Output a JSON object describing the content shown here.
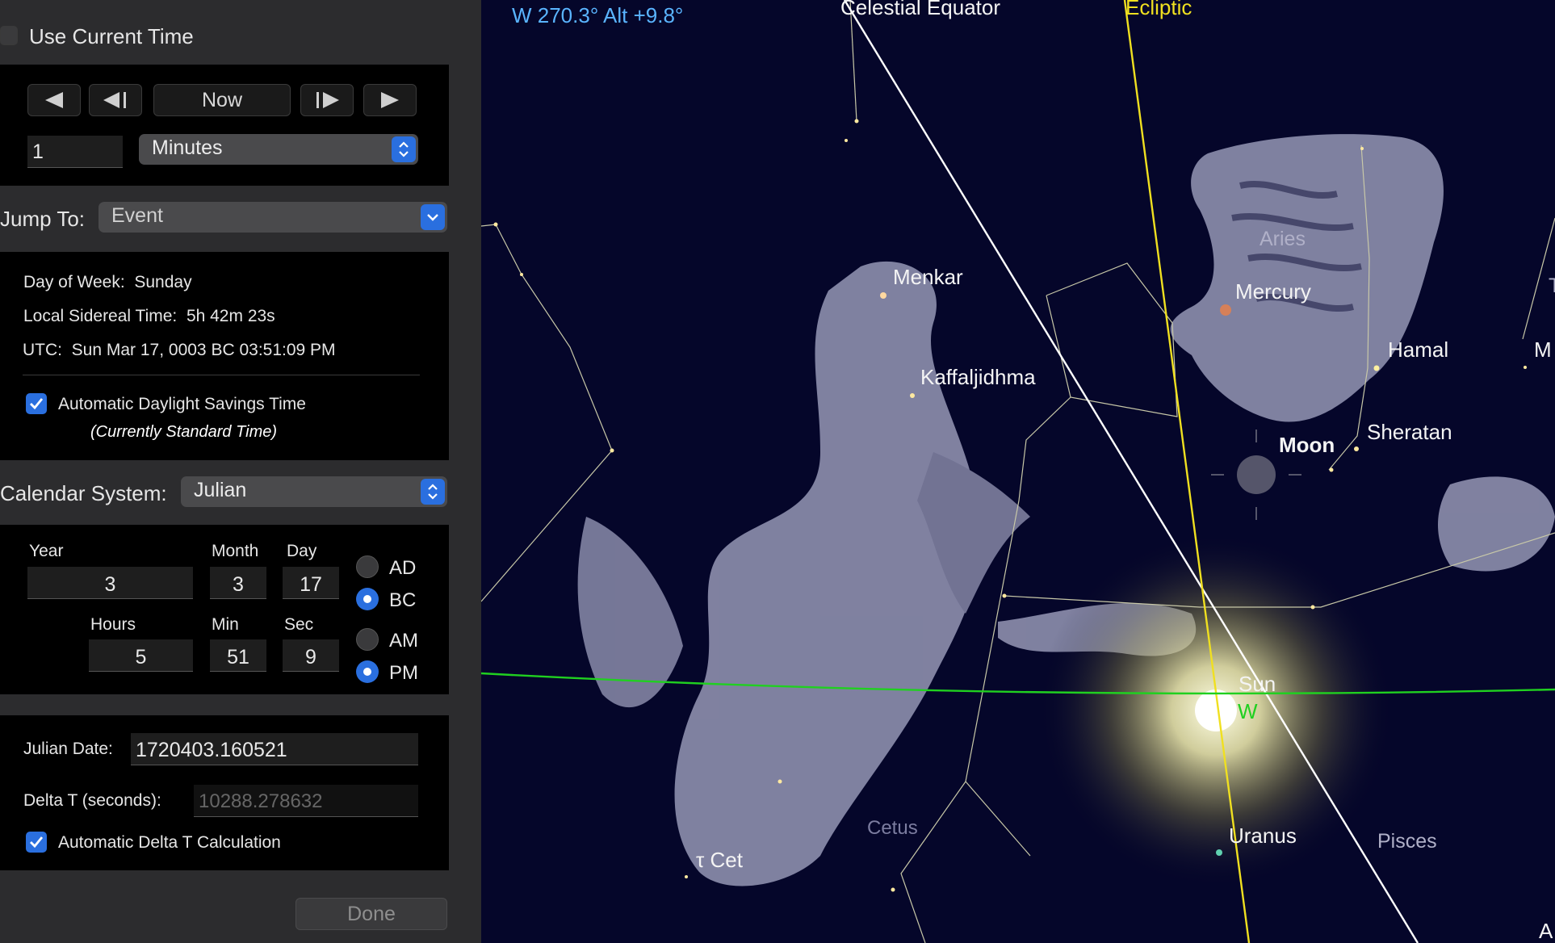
{
  "panel": {
    "use_current_time": "Use Current Time",
    "nav": {
      "now_label": "Now"
    },
    "step_value": "1",
    "step_unit": "Minutes",
    "jump_to_label": "Jump To:",
    "jump_to_value": "Event",
    "info": {
      "day_of_week_label": "Day of Week:",
      "day_of_week": "Sunday",
      "lst_label": "Local Sidereal Time:",
      "lst": "5h 42m 23s",
      "utc_label": "UTC:",
      "utc": "Sun Mar 17, 0003 BC 03:51:09 PM"
    },
    "auto_dst_label": "Automatic Daylight Savings Time",
    "dst_status": "(Currently Standard Time)",
    "calendar_label": "Calendar System:",
    "calendar_value": "Julian",
    "date": {
      "year_label": "Year",
      "year": "3",
      "month_label": "Month",
      "month": "3",
      "day_label": "Day",
      "day": "17",
      "hours_label": "Hours",
      "hours": "5",
      "min_label": "Min",
      "min": "51",
      "sec_label": "Sec",
      "sec": "9",
      "ad": "AD",
      "bc": "BC",
      "am": "AM",
      "pm": "PM"
    },
    "julian_date_label": "Julian Date:",
    "julian_date": "1720403.160521",
    "delta_t_label": "Delta T (seconds):",
    "delta_t": "10288.278632",
    "auto_delta_t_label": "Automatic Delta T Calculation",
    "done": "Done"
  },
  "sky": {
    "pointer_readout": "W 270.3° Alt +9.8°",
    "lines": {
      "celestial_equator": "Celestial Equator",
      "ecliptic": "Ecliptic"
    },
    "labels": {
      "aries": "Aries",
      "mercury": "Mercury",
      "menkar": "Menkar",
      "hamal": "Hamal",
      "kaffaljidhma": "Kaffaljidhma",
      "moon": "Moon",
      "sheratan": "Sheratan",
      "sun": "Sun",
      "west": "W",
      "uranus": "Uranus",
      "pisces": "Pisces",
      "cetus": "Cetus",
      "tau_cet": "τ Cet",
      "edge_t": "T",
      "edge_m": "M",
      "edge_a": "A"
    },
    "colors": {
      "equator": "#ffffff",
      "ecliptic": "#f0e020",
      "horizon": "#20d020",
      "readout": "#5ab4ff",
      "background": "#05062a"
    }
  }
}
